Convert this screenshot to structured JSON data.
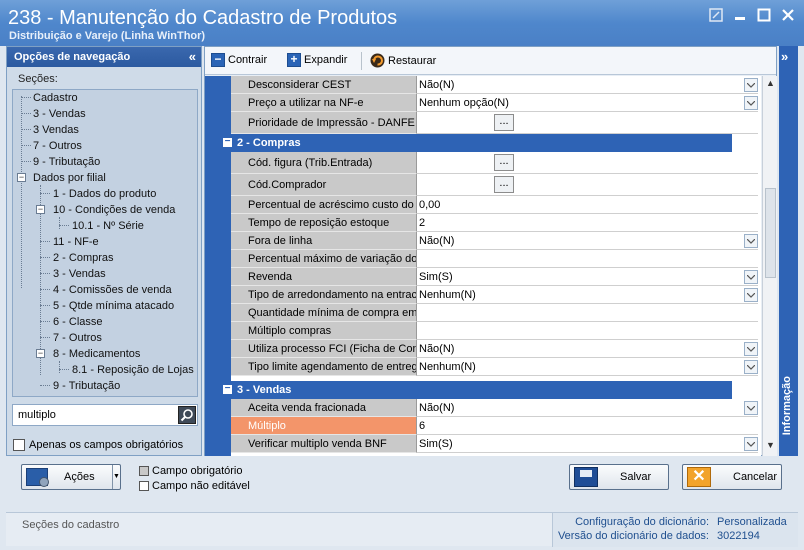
{
  "window": {
    "title": "238 - Manutenção do Cadastro de Produtos",
    "subtitle": "Distribuição e Varejo (Linha WinThor)"
  },
  "nav": {
    "header": "Opções de navegação",
    "sections_label": "Seções:",
    "tree": [
      {
        "label": "Cadastro"
      },
      {
        "label": "3 - Vendas"
      },
      {
        "label": "3 Vendas"
      },
      {
        "label": "7 - Outros"
      },
      {
        "label": "9 - Tributação"
      },
      {
        "label": "Dados por filial"
      },
      {
        "label": "1 - Dados do produto"
      },
      {
        "label": "10 - Condições de venda"
      },
      {
        "label": "10.1 - Nº Série"
      },
      {
        "label": "11 - NF-e"
      },
      {
        "label": "2 - Compras"
      },
      {
        "label": "3 - Vendas"
      },
      {
        "label": "4 - Comissões de venda"
      },
      {
        "label": "5 - Qtde mínima atacado"
      },
      {
        "label": "6 - Classe"
      },
      {
        "label": "7 - Outros"
      },
      {
        "label": "8 - Medicamentos"
      },
      {
        "label": "8.1 -  Reposição de Lojas"
      },
      {
        "label": "9 - Tributação"
      }
    ],
    "search_value": "multiplo",
    "required_only_label": "Apenas os campos obrigatórios"
  },
  "toolbar": {
    "collapse_label": "Contrair",
    "expand_label": "Expandir",
    "restore_label": "Restaurar"
  },
  "grid": {
    "rows_top": [
      {
        "label": "Desconsiderar CEST",
        "value": "Não(N)"
      },
      {
        "label": "Preço a utilizar na NF-e",
        "value": "Nenhum opção(N)"
      },
      {
        "label": "Prioridade de Impressão - DANFE",
        "value": ""
      }
    ],
    "group_compras": "2 - Compras",
    "rows_compras": [
      {
        "label": "Cód. figura (Trib.Entrada)",
        "value": ""
      },
      {
        "label": "Cód.Comprador",
        "value": ""
      },
      {
        "label": "Percentual de acréscimo custo do p",
        "value": "0,00"
      },
      {
        "label": "Tempo de reposição estoque",
        "value": "2"
      },
      {
        "label": "Fora de linha",
        "value": "Não(N)"
      },
      {
        "label": "Percentual máximo de variação do",
        "value": ""
      },
      {
        "label": "Revenda",
        "value": "Sim(S)"
      },
      {
        "label": "Tipo de arredondamento na entrac",
        "value": "Nenhum(N)"
      },
      {
        "label": "Quantidade mínima de compra emb",
        "value": ""
      },
      {
        "label": "Múltiplo compras",
        "value": ""
      },
      {
        "label": "Utiliza processo FCI (Ficha de Con",
        "value": "Não(N)"
      },
      {
        "label": "Tipo limite agendamento de entreg",
        "value": "Nenhum(N)"
      }
    ],
    "group_vendas": "3 - Vendas",
    "rows_vendas": [
      {
        "label": "Aceita venda fracionada",
        "value": "Não(N)"
      },
      {
        "label": "Múltiplo",
        "value": "6"
      },
      {
        "label": "Verificar multiplo venda BNF",
        "value": "Sim(S)"
      }
    ]
  },
  "info_panel": {
    "label": "Informação"
  },
  "footer": {
    "acoes_label": "Ações",
    "legend_required": "Campo obrigatório",
    "legend_readonly": "Campo não editável",
    "save_label": "Salvar",
    "cancel_label": "Cancelar"
  },
  "status": {
    "left": "Seções do cadastro",
    "config_label": "Configuração do dicionário:",
    "config_value": "Personalizada",
    "version_label": "Versão do dicionário de dados:",
    "version_value": "3022194"
  },
  "colors": {
    "accent_blue": "#2e63b5",
    "highlight_orange": "#f3956a",
    "legend_required": "#c8c8c8",
    "legend_readonly": "#ffffff"
  }
}
